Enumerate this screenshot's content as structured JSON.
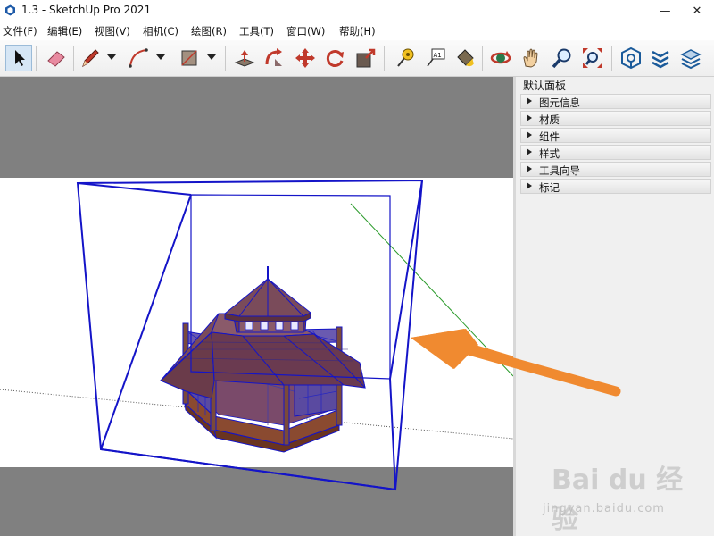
{
  "window": {
    "title": "1.3 - SketchUp Pro 2021",
    "minimize": "—",
    "close": "✕"
  },
  "menu": [
    "文件(F)",
    "编辑(E)",
    "视图(V)",
    "相机(C)",
    "绘图(R)",
    "工具(T)",
    "窗口(W)",
    "帮助(H)"
  ],
  "toolbar": {
    "tools": [
      "select",
      "eraser",
      "pencil",
      "arc",
      "rectangle",
      "push-pull",
      "follow-me",
      "move",
      "rotate",
      "scale",
      "tape-measure",
      "text",
      "paint-bucket",
      "orbit",
      "pan",
      "zoom",
      "zoom-extents",
      "3d-warehouse",
      "extension-warehouse",
      "layout"
    ],
    "text_tool_glyph": "A1"
  },
  "panel": {
    "title": "默认面板",
    "trays": [
      "图元信息",
      "材质",
      "组件",
      "样式",
      "工具向导",
      "标记"
    ]
  },
  "colors": {
    "sky": "#808080",
    "ground": "#808080",
    "selection_blue": "#1414c8",
    "green_axis": "#2a9a2a",
    "annotation_arrow": "#f08a30",
    "roof": "#7a4b5a",
    "wood": "#7a4a3a"
  },
  "watermark": {
    "logo": "Bai du 经验",
    "url": "jingyan.baidu.com"
  }
}
